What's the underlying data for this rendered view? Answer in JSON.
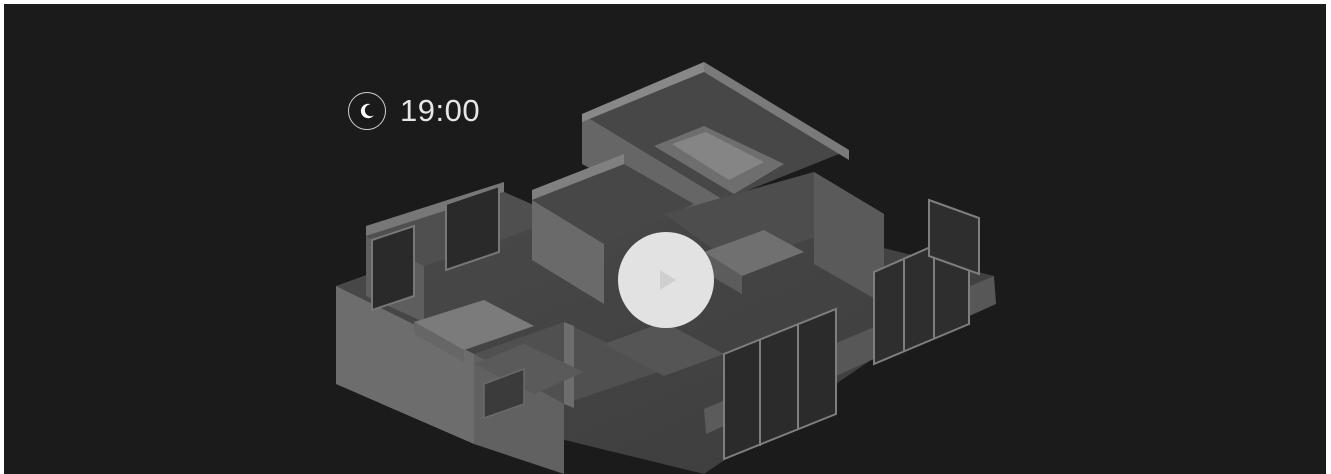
{
  "video": {
    "time_label": "19:00",
    "time_icon": "moon-icon",
    "play_icon": "play-icon",
    "theme": {
      "background": "#1b1b1b",
      "play_button": "#e2e2e2",
      "text": "#e6e6e6"
    }
  }
}
